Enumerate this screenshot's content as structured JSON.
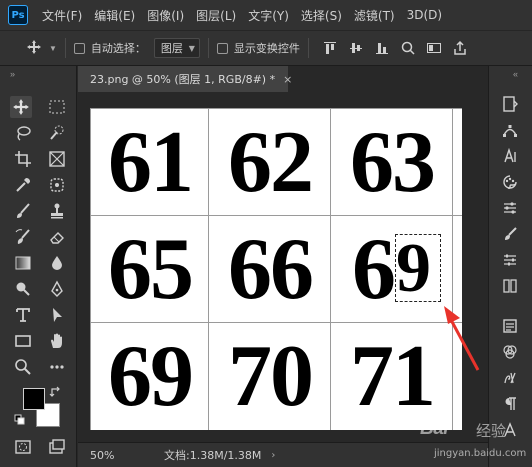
{
  "app": {
    "logo_text": "Ps",
    "accent": "#31a8ff"
  },
  "menu": {
    "items": [
      {
        "label": "文件(F)"
      },
      {
        "label": "编辑(E)"
      },
      {
        "label": "图像(I)"
      },
      {
        "label": "图层(L)"
      },
      {
        "label": "文字(Y)"
      },
      {
        "label": "选择(S)"
      },
      {
        "label": "滤镜(T)"
      },
      {
        "label": "3D(D)"
      }
    ]
  },
  "options_bar": {
    "auto_select_label": "自动选择：",
    "auto_select_target": "图层",
    "show_transform_label": "显示变换控件"
  },
  "toolbar": {
    "tools": [
      "move-tool",
      "marquee-tool",
      "lasso-tool",
      "quick-select-tool",
      "crop-tool",
      "frame-tool",
      "eyedropper-tool",
      "spot-heal-tool",
      "brush-tool",
      "clone-stamp-tool",
      "history-brush-tool",
      "eraser-tool",
      "gradient-tool",
      "blur-tool",
      "dodge-tool",
      "pen-tool",
      "type-tool",
      "path-select-tool",
      "rectangle-tool",
      "hand-tool",
      "zoom-tool",
      "more-tools"
    ],
    "foreground_color": "#000000",
    "background_color": "#ffffff"
  },
  "document": {
    "tab_title": "23.png @ 50% (图层 1, RGB/8#) *",
    "close_glyph": "×"
  },
  "canvas": {
    "cells": [
      {
        "label": "61"
      },
      {
        "label": "62"
      },
      {
        "label": "63"
      },
      {
        "label": "65"
      },
      {
        "label": "66"
      },
      {
        "label": "6"
      },
      {
        "label": "69"
      },
      {
        "label": "70"
      },
      {
        "label": "71"
      }
    ],
    "selected_fragment": "9"
  },
  "status": {
    "zoom": "50%",
    "doc_info": "文档:1.38M/1.38M",
    "more_glyph": "›"
  },
  "watermark": {
    "brand": "Bai",
    "brand_cn": "经验",
    "url": "jingyan.baidu.com"
  }
}
